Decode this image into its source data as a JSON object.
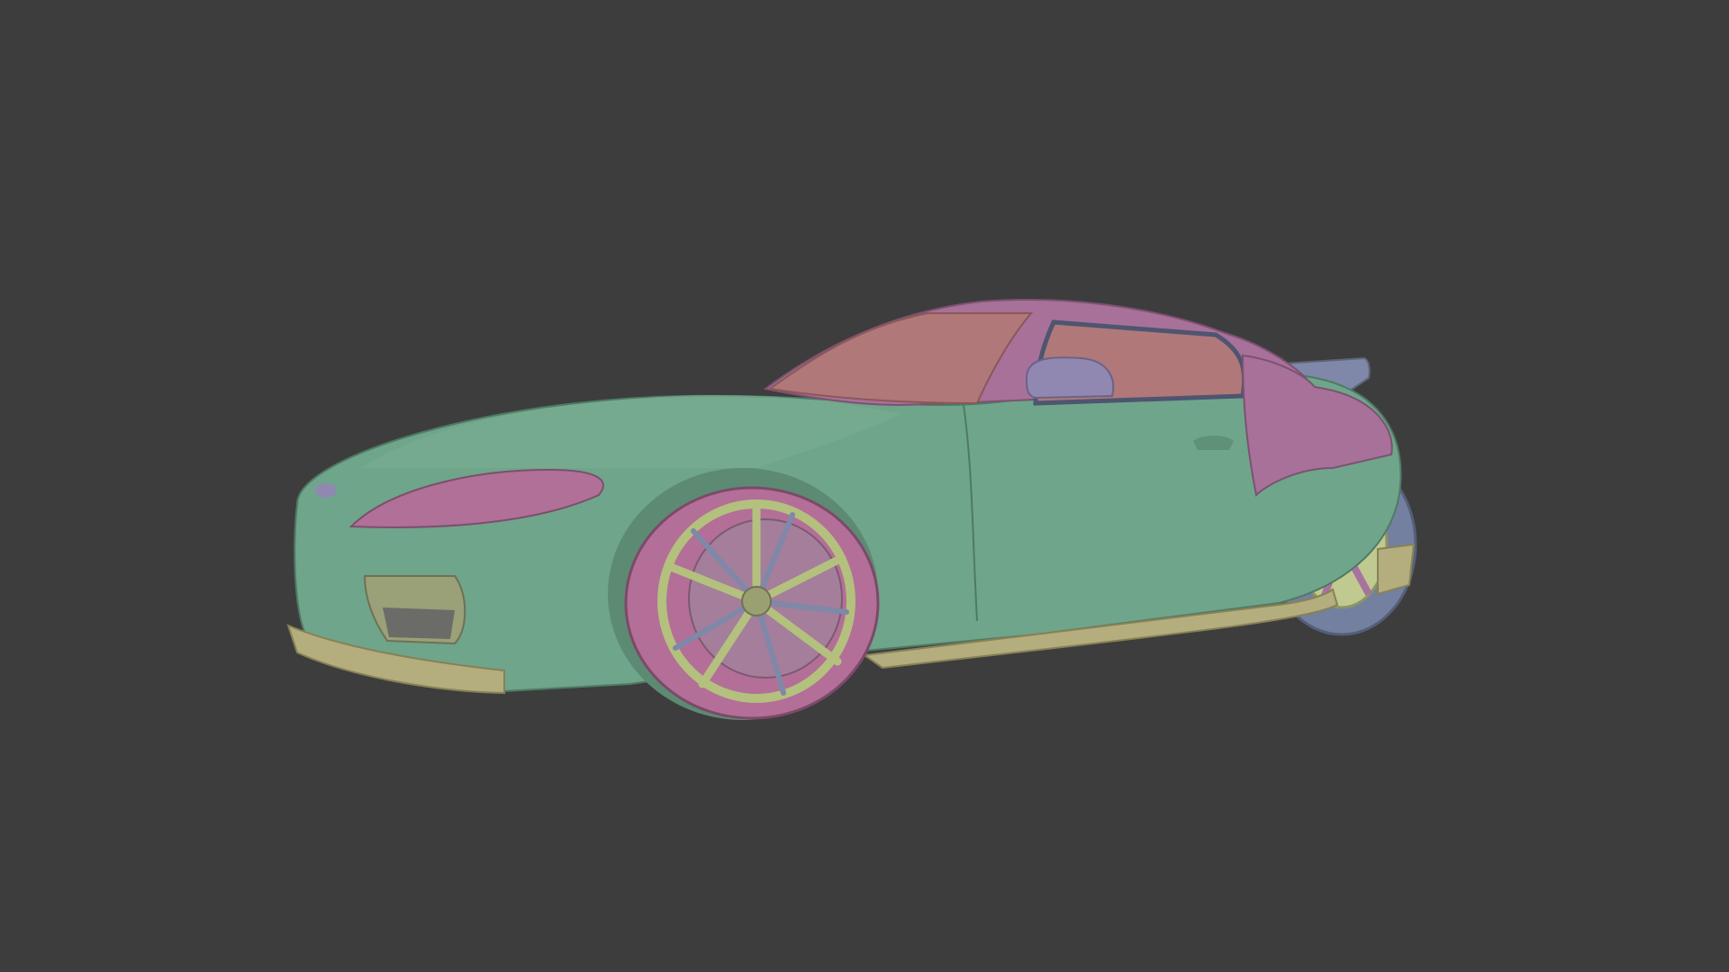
{
  "viewport": {
    "background_color": "#3d3d3d",
    "shading_mode": "solid-random-color"
  },
  "model": {
    "parts": [
      {
        "name": "body",
        "color": "#6fa58a"
      },
      {
        "name": "roof",
        "color": "#a7719a"
      },
      {
        "name": "windows",
        "color": "#b07878"
      },
      {
        "name": "headlights",
        "color": "#b07098"
      },
      {
        "name": "lower-trim",
        "color": "#b4ad7d"
      },
      {
        "name": "spoiler",
        "color": "#7f88a8"
      },
      {
        "name": "front-tire",
        "color": "#b36f98"
      },
      {
        "name": "rear-tire",
        "color": "#7380a0"
      },
      {
        "name": "rim",
        "color": "#b4c07d"
      },
      {
        "name": "mirror",
        "color": "#9188b2"
      }
    ]
  }
}
